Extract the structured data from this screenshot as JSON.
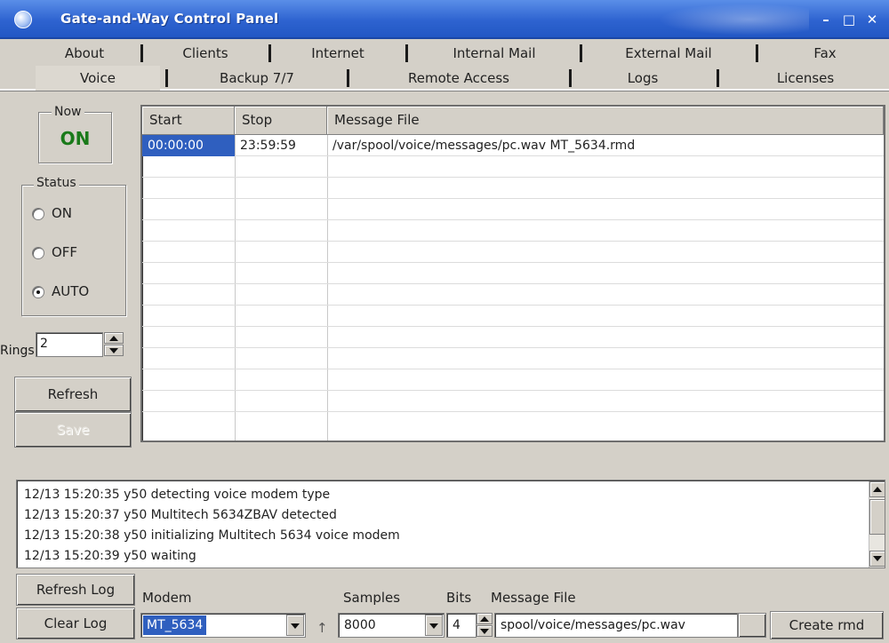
{
  "window": {
    "title": "Gate-and-Way Control Panel",
    "controls": {
      "minimize": "–",
      "maximize": "□",
      "close": "✕"
    }
  },
  "tabs": {
    "row1": [
      "About",
      "Clients",
      "Internet",
      "Internal Mail",
      "External Mail",
      "Fax"
    ],
    "row2": [
      "Voice",
      "Backup 7/7",
      "Remote Access",
      "Logs",
      "Licenses"
    ],
    "active": "Voice"
  },
  "left_panel": {
    "now_label": "Now",
    "now_value": "ON",
    "status_label": "Status",
    "status_options": [
      "ON",
      "OFF",
      "AUTO"
    ],
    "status_selected": "AUTO",
    "rings_label": "Rings",
    "rings_value": "2",
    "refresh_label": "Refresh",
    "save_label": "Save"
  },
  "schedule": {
    "columns": [
      "Start",
      "Stop",
      "Message File"
    ],
    "rows": [
      {
        "start": "00:00:00",
        "stop": "23:59:59",
        "file": "/var/spool/voice/messages/pc.wav MT_5634.rmd"
      }
    ],
    "selected_cell": "start"
  },
  "log": {
    "lines": [
      "12/13 15:20:35 y50  detecting voice modem type",
      "12/13 15:20:37 y50  Multitech 5634ZBAV detected",
      "12/13 15:20:38 y50  initializing Multitech 5634 voice modem",
      "12/13 15:20:39 y50  waiting"
    ]
  },
  "bottom": {
    "refresh_log_label": "Refresh Log",
    "clear_log_label": "Clear Log",
    "modem_label": "Modem",
    "modem_value": "MT_5634",
    "samples_label": "Samples",
    "samples_value": "8000",
    "bits_label": "Bits",
    "bits_value": "4",
    "message_file_label": "Message File",
    "message_file_value": "spool/voice/messages/pc.wav",
    "create_label": "Create rmd",
    "arrow_glyph": "↑"
  }
}
